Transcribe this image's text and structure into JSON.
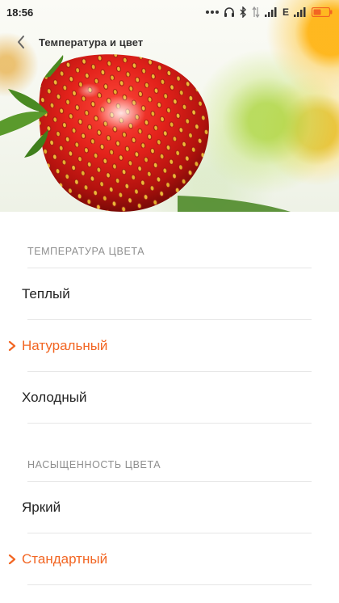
{
  "status_bar": {
    "time": "18:56",
    "network_label": "E",
    "accent_color": "#f26522"
  },
  "header": {
    "back_icon": "chevron-left-icon",
    "title": "Температура и цвет"
  },
  "sections": [
    {
      "title": "ТЕМПЕРАТУРА ЦВЕТА",
      "options": [
        {
          "label": "Теплый",
          "selected": false
        },
        {
          "label": "Натуральный",
          "selected": true
        },
        {
          "label": "Холодный",
          "selected": false
        }
      ]
    },
    {
      "title": "НАСЫЩЕННОСТЬ ЦВЕТА",
      "options": [
        {
          "label": "Яркий",
          "selected": false
        },
        {
          "label": "Стандартный",
          "selected": true
        }
      ]
    }
  ],
  "colors": {
    "selected_text": "#f26522",
    "section_title": "#8e8e8e",
    "divider": "#e6e6e6"
  }
}
